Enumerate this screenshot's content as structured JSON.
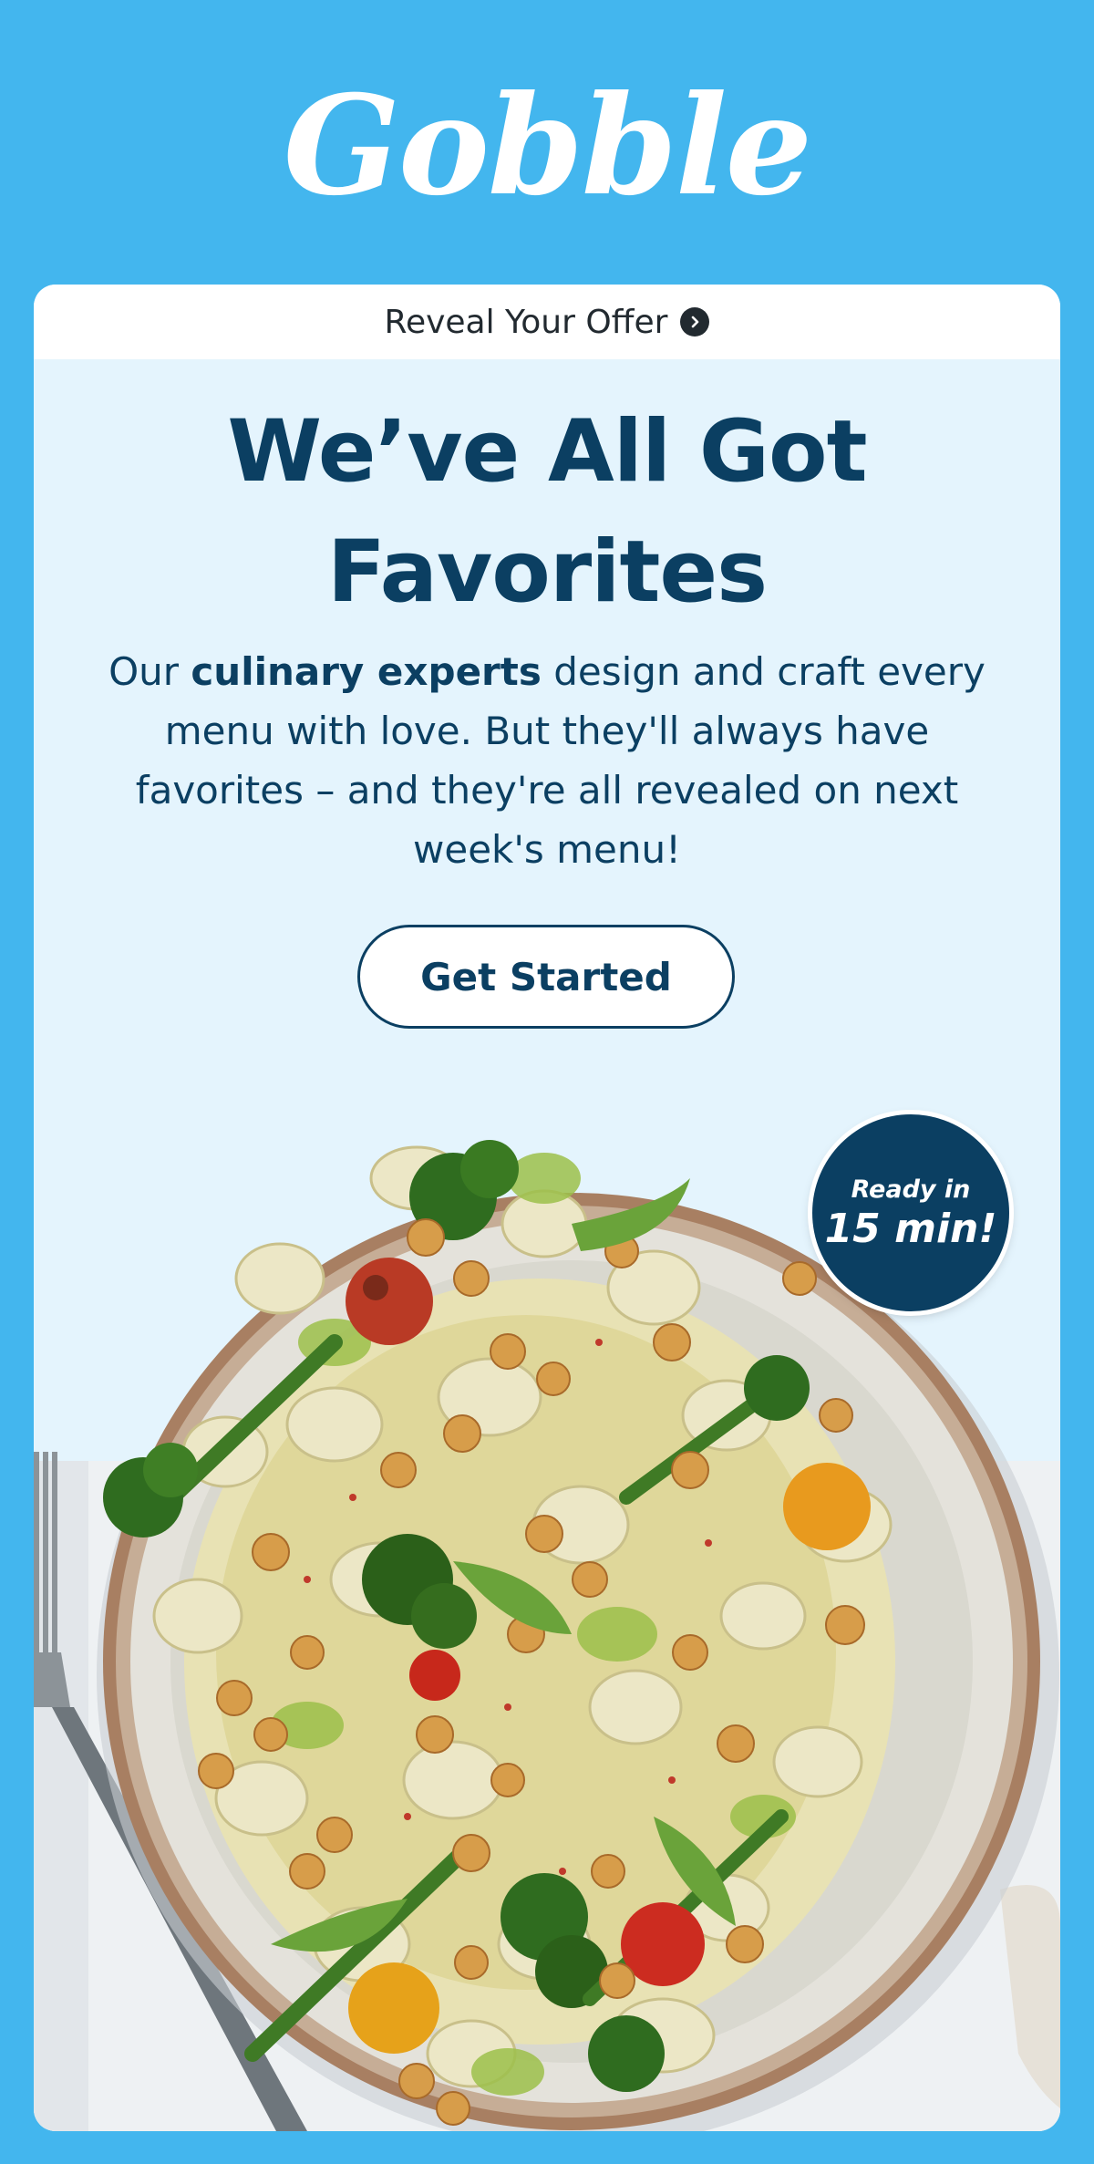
{
  "brand": {
    "logo_text": "Gobble"
  },
  "offer_bar": {
    "label": "Reveal Your Offer",
    "icon": "chevron-right-circle-icon"
  },
  "hero": {
    "headline_line1": "We’ve All Got",
    "headline_line2": "Favorites",
    "body_pre": "Our ",
    "body_bold": "culinary experts",
    "body_post": " design and craft every menu with love. But they'll always have favorites – and they're all revealed on next week's menu!",
    "cta_label": "Get Started"
  },
  "badge": {
    "line1": "Ready in",
    "line2": "15 min!"
  },
  "colors": {
    "background": "#43b6ee",
    "card_background": "#e4f4fd",
    "navy": "#0b3f62"
  }
}
